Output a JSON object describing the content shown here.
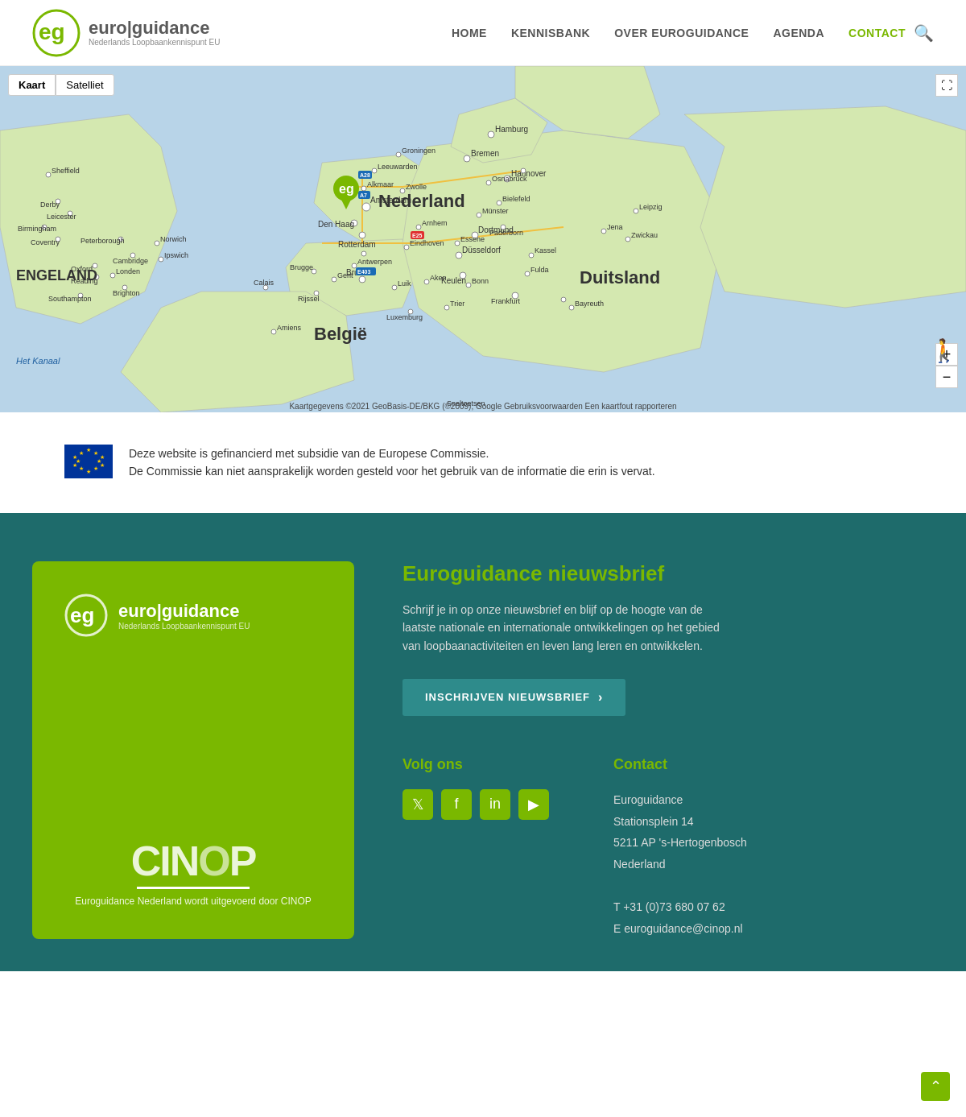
{
  "header": {
    "logo_main": "euro|guidance",
    "logo_sub": "Nederlands Loopbaankennispunt EU",
    "nav": {
      "home": "HOME",
      "kennisbank": "KENNISBANK",
      "over": "OVER EUROGUIDANCE",
      "agenda": "AGENDA",
      "contact": "CONTACT"
    }
  },
  "map": {
    "toggle_kaart": "Kaart",
    "toggle_satelliet": "Satelliet",
    "label_nederland": "Nederland",
    "label_belgie": "België",
    "label_duitsland": "Duitsland",
    "label_engeland": "ENGELAND",
    "attribution": "Kaartgegevens ©2021 GeoBasis-DE/BKG (©2009), Google  Gebruiksvoorwaarden  Een kaartfout rapporteren"
  },
  "eu_disclaimer": {
    "line1": "Deze website is gefinancierd met subsidie van de Europese Commissie.",
    "line2": "De Commissie kan niet aansprakelijk worden gesteld voor het gebruik van de informatie die erin is vervat."
  },
  "footer": {
    "logo_main": "euro|guidance",
    "logo_sub": "Nederlands Loopbaankennispunt EU",
    "cinop_label": "CINOP",
    "cinop_tagline": "Euroguidance Nederland wordt uitgevoerd door CINOP",
    "newsletter_title": "Euroguidance nieuwsbrief",
    "newsletter_desc": "Schrijf je in op onze nieuwsbrief en blijf op de hoogte van de laatste nationale en internationale ontwikkelingen op het gebied van loopbaanactiviteiten en leven lang leren en ontwikkelen.",
    "newsletter_btn": "INSCHRIJVEN NIEUWSBRIEF",
    "volg_ons": "Volg ons",
    "contact_title": "Contact",
    "contact_info": {
      "org": "Euroguidance",
      "street": "Stationsplein 14",
      "postal": "5211 AP 's-Hertogenbosch",
      "country": "Nederland",
      "phone": "T +31 (0)73 680 07 62",
      "email": "E euroguidance@cinop.nl"
    }
  }
}
